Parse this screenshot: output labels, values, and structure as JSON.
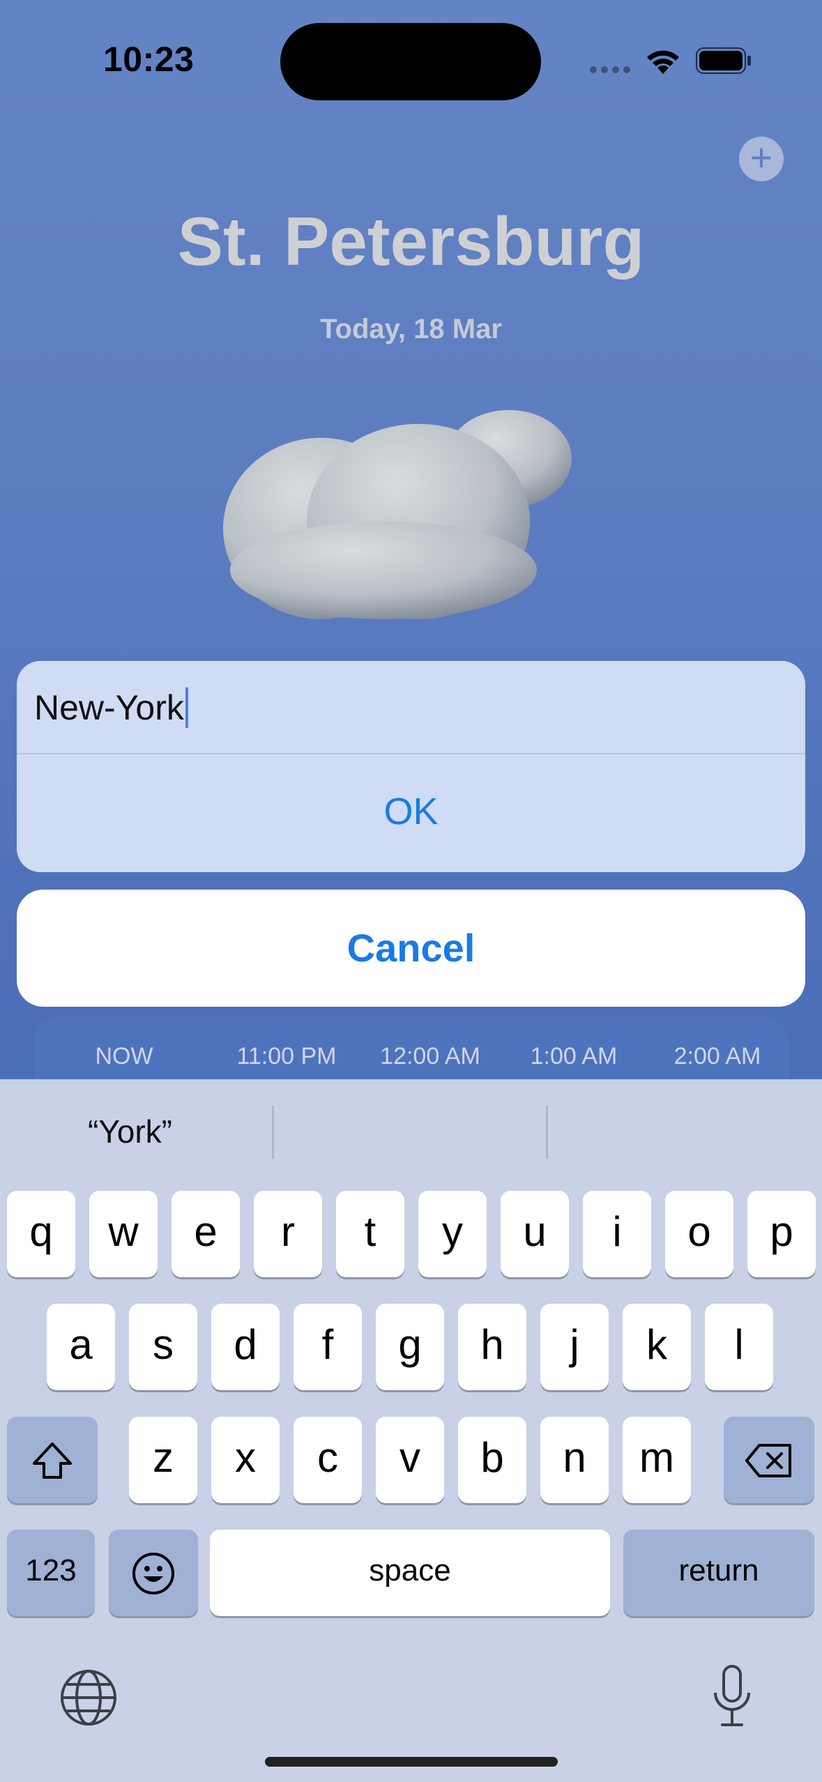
{
  "status_bar": {
    "time": "10:23"
  },
  "header": {
    "city": "St. Petersburg",
    "date": "Today, 18 Mar",
    "add_icon": "plus-icon"
  },
  "weather": {
    "icon": "cloud-icon"
  },
  "alert": {
    "input_value": "New-York",
    "ok_label": "OK"
  },
  "cancel_label": "Cancel",
  "hourly": {
    "times": [
      "NOW",
      "11:00 PM",
      "12:00 AM",
      "1:00 AM",
      "2:00 AM"
    ]
  },
  "keyboard": {
    "suggestions": [
      "“York”",
      "",
      ""
    ],
    "row1": [
      "q",
      "w",
      "e",
      "r",
      "t",
      "y",
      "u",
      "i",
      "o",
      "p"
    ],
    "row2": [
      "a",
      "s",
      "d",
      "f",
      "g",
      "h",
      "j",
      "k",
      "l"
    ],
    "row3": [
      "z",
      "x",
      "c",
      "v",
      "b",
      "n",
      "m"
    ],
    "numbers_label": "123",
    "space_label": "space",
    "return_label": "return"
  }
}
